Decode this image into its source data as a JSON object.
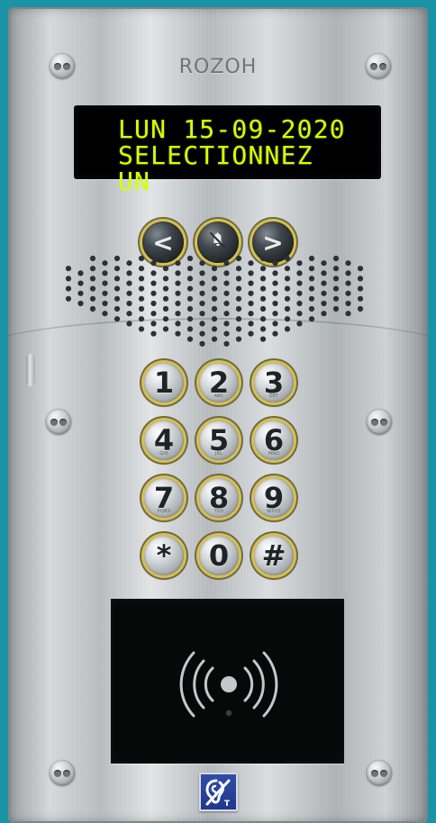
{
  "brand": {
    "name": "ROZOH"
  },
  "display": {
    "line1": "LUN 15-09-2020",
    "line2": "SELECTIONNEZ UN"
  },
  "navigation": {
    "left": "<",
    "bell_icon": "bell-icon",
    "right": ">"
  },
  "keypad": {
    "keys": [
      {
        "value": "1",
        "letters": ""
      },
      {
        "value": "2",
        "letters": "ABC"
      },
      {
        "value": "3",
        "letters": "DEF"
      },
      {
        "value": "4",
        "letters": "GHI"
      },
      {
        "value": "5",
        "letters": "JKL"
      },
      {
        "value": "6",
        "letters": "MNO"
      },
      {
        "value": "7",
        "letters": "PQRS"
      },
      {
        "value": "8",
        "letters": "TUV"
      },
      {
        "value": "9",
        "letters": "WXYZ"
      },
      {
        "value": "*",
        "letters": ""
      },
      {
        "value": "0",
        "letters": ""
      },
      {
        "value": "#",
        "letters": ""
      }
    ]
  },
  "reader": {
    "icon": "contactless-icon"
  },
  "accessibility": {
    "icon": "hearing-assist-icon",
    "badge": "T"
  },
  "colors": {
    "background": "#1b93a6",
    "display_text": "#d7ff00",
    "button_ring": "#d7c04b",
    "panel": "#cfd3d6"
  }
}
